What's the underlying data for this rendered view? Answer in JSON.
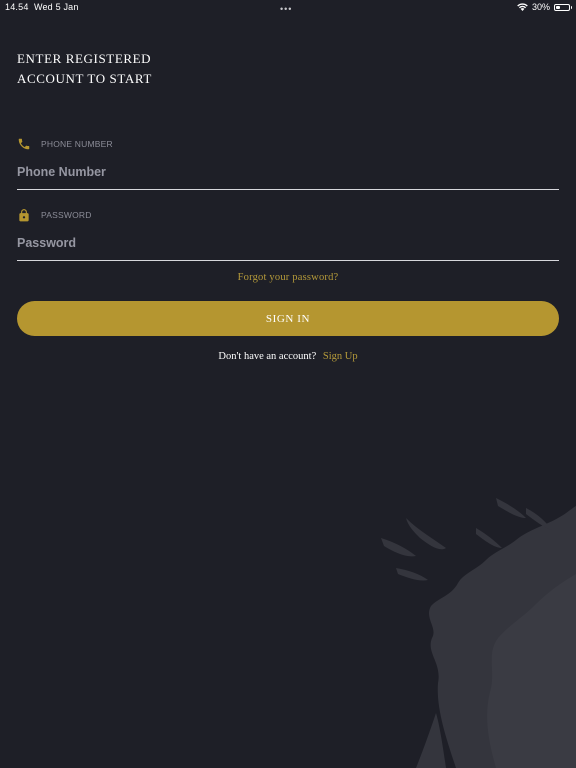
{
  "status_bar": {
    "time": "14.54",
    "date": "Wed 5 Jan",
    "dots": "•••",
    "battery_percent": "30%",
    "battery_level": 0.3,
    "wifi_icon": "wifi-icon",
    "battery_icon": "battery-icon"
  },
  "heading": {
    "line1": "ENTER REGISTERED",
    "line2": "ACCOUNT TO START"
  },
  "phone_field": {
    "icon": "phone-icon",
    "label": "PHONE NUMBER",
    "placeholder": "Phone Number",
    "value": ""
  },
  "password_field": {
    "icon": "lock-icon",
    "label": "PASSWORD",
    "placeholder": "Password",
    "value": ""
  },
  "forgot_password": "Forgot your password?",
  "sign_in_label": "SIGN IN",
  "signup": {
    "prompt": "Don't have an account?",
    "link": "Sign Up"
  },
  "colors": {
    "background": "#1e1f27",
    "accent": "#b59630",
    "link": "#b59a3a",
    "muted_label": "#8c8d98"
  }
}
